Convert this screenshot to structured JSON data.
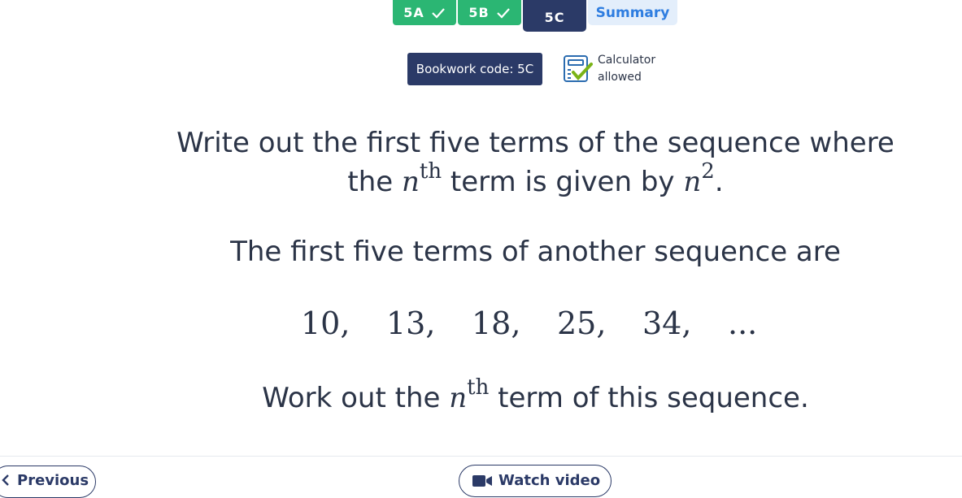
{
  "tabs": {
    "t5a": "5A",
    "t5b": "5B",
    "t5c": "5C",
    "summary": "Summary"
  },
  "bookwork": "Bookwork code: 5C",
  "calculator": {
    "line1": "Calculator",
    "line2": "allowed"
  },
  "question": {
    "part1_line1": "Write out the first five terms of the sequence where",
    "part1_line2_a": "the ",
    "n": "n",
    "th": "th",
    "part1_line2_b": " term is given by ",
    "power": "2",
    "period": ".",
    "part2": "The first five terms of another sequence are",
    "sequence": [
      "10,",
      "13,",
      "18,",
      "25,",
      "34,",
      "..."
    ],
    "part3_a": "Work out the ",
    "part3_b": " term of this sequence."
  },
  "nav": {
    "previous": "Previous",
    "watch_video": "Watch video"
  },
  "colors": {
    "done": "#2bb673",
    "current": "#2b3a67",
    "summary_bg": "#e3eefb",
    "summary_text": "#2e7de0"
  }
}
